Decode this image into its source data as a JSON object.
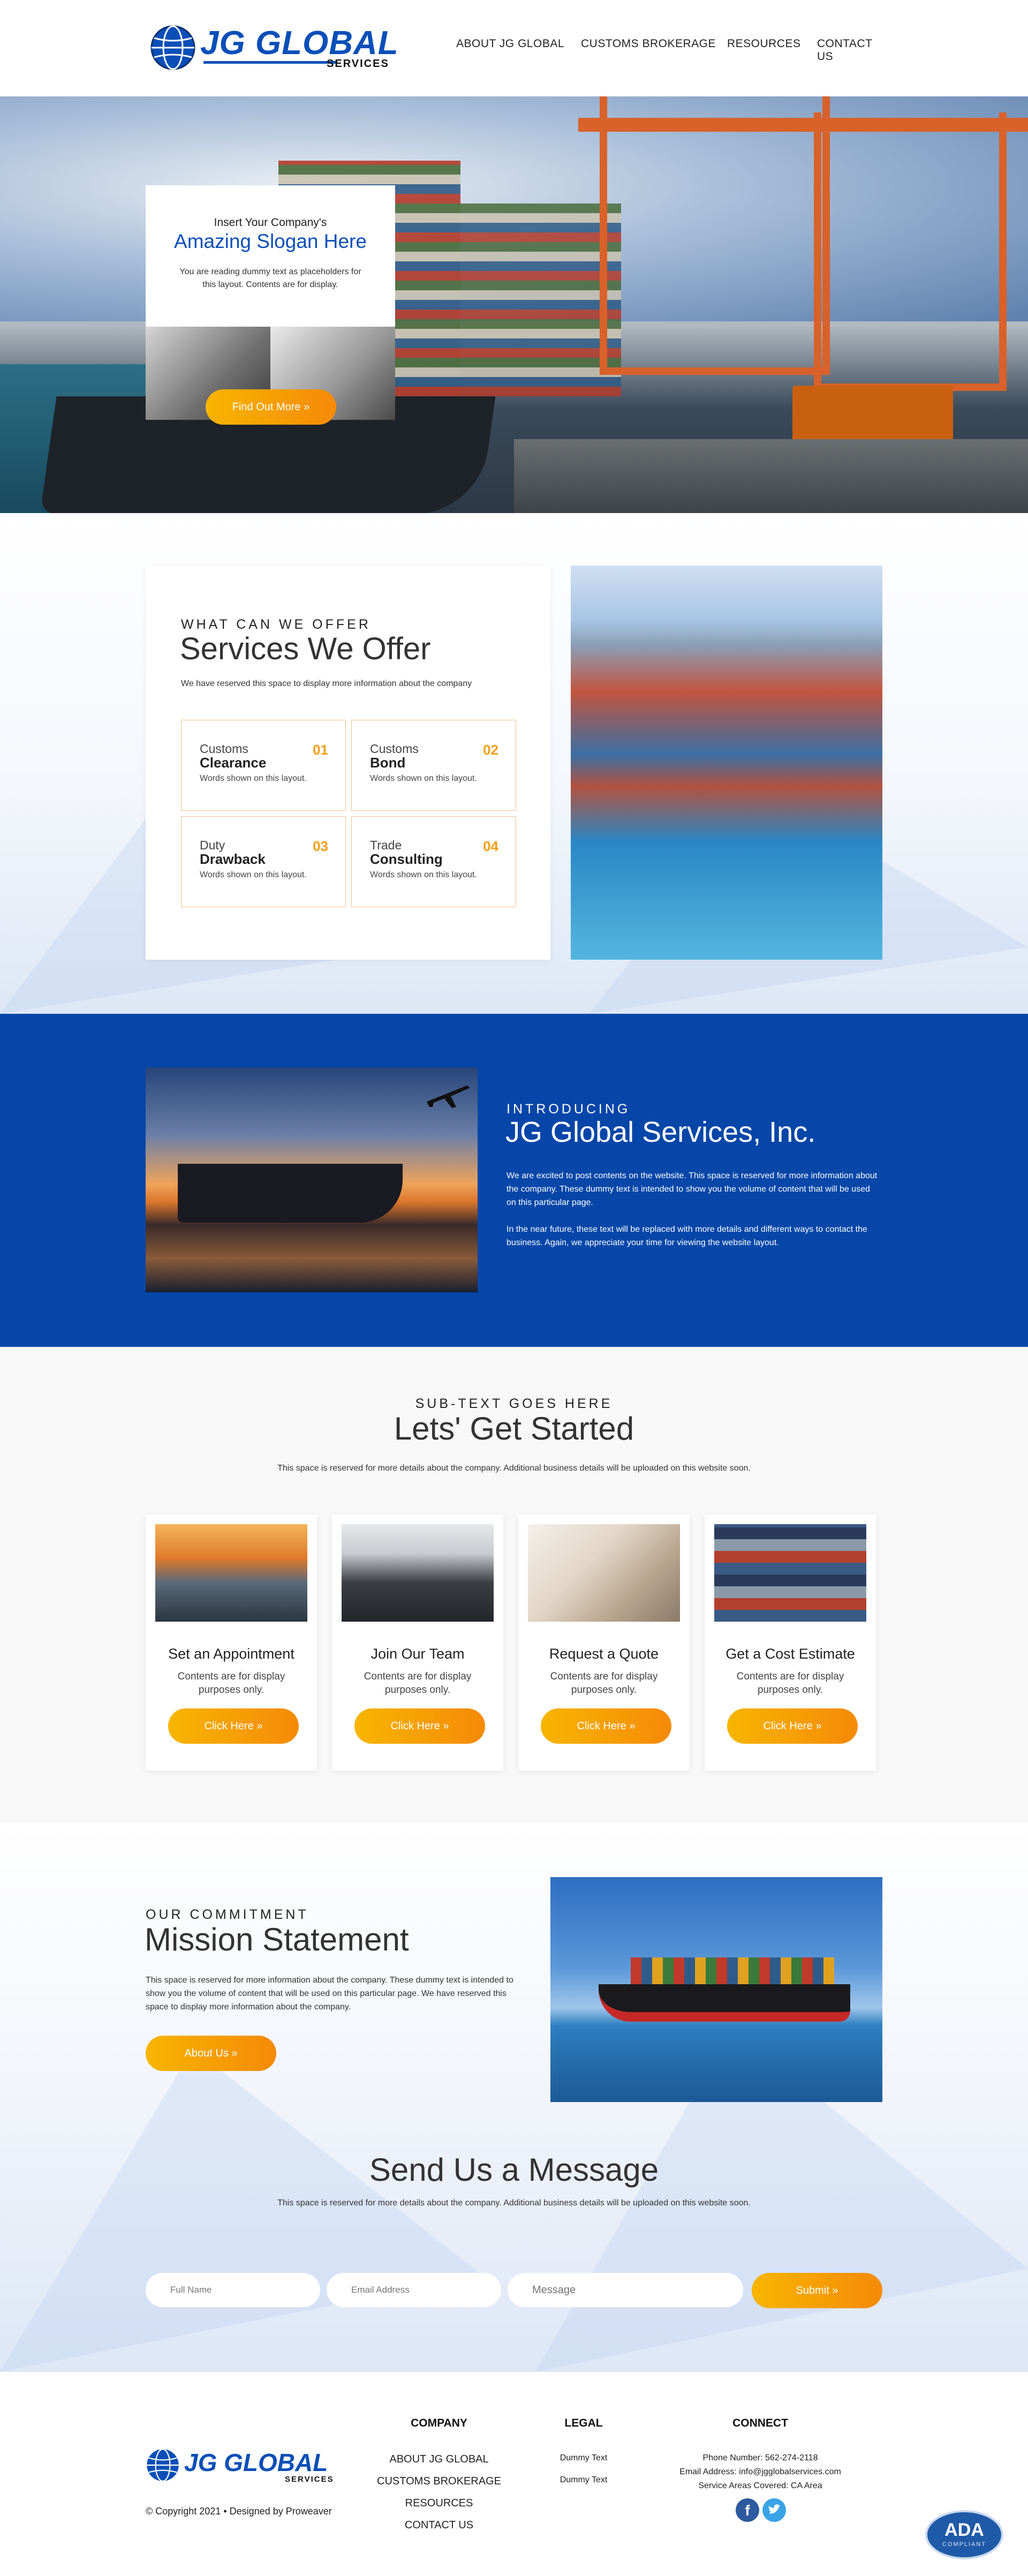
{
  "colors": {
    "brand_blue": "#0546a8",
    "accent_orange": "#f59f14",
    "dark_text": "#222222"
  },
  "header": {
    "logo": {
      "main": "JG GLOBAL",
      "sub": "SERVICES"
    },
    "nav": [
      "ABOUT JG GLOBAL",
      "CUSTOMS BROKERAGE",
      "RESOURCES",
      "CONTACT US"
    ]
  },
  "hero": {
    "pre": "Insert Your Company's",
    "slogan": "Amazing Slogan Here",
    "desc": "You are reading dummy text as placeholders for this layout. Contents are for display.",
    "button": "Find Out More »"
  },
  "services": {
    "eyebrow": "WHAT CAN WE OFFER",
    "title": "Services We Offer",
    "desc": "We have reserved this space to display more information about the company",
    "items": [
      {
        "line1": "Customs",
        "line2": "Clearance",
        "num": "01",
        "desc": "Words shown on this layout."
      },
      {
        "line1": "Customs",
        "line2": "Bond",
        "num": "02",
        "desc": "Words shown on this layout."
      },
      {
        "line1": "Duty",
        "line2": "Drawback",
        "num": "03",
        "desc": "Words shown on this layout."
      },
      {
        "line1": "Trade",
        "line2": "Consulting",
        "num": "04",
        "desc": "Words shown on this layout."
      }
    ]
  },
  "intro": {
    "eyebrow": "INTRODUCING",
    "title": "JG Global Services, Inc.",
    "p1": "We are excited to post contents on the website. This space is reserved for more information about the company. These dummy text is intended to show you the volume of content that will be used on this particular page.",
    "p2": "In the near future, these text will be replaced with more details and different ways to contact the business.  Again, we appreciate your time for viewing the website layout."
  },
  "started": {
    "eyebrow": "SUB-TEXT GOES HERE",
    "title": "Lets' Get Started",
    "desc": "This space is reserved for more details about the company. Additional business details will be uploaded on this website soon.",
    "cards": [
      {
        "title": "Set an Appointment",
        "text": "Contents are for display purposes only.",
        "button": "Click Here »"
      },
      {
        "title": "Join Our Team",
        "text": "Contents are for display purposes only.",
        "button": "Click Here »"
      },
      {
        "title": "Request a Quote",
        "text": "Contents are for display purposes only.",
        "button": "Click Here »"
      },
      {
        "title": "Get a Cost Estimate",
        "text": "Contents are for display purposes only.",
        "button": "Click Here »"
      }
    ]
  },
  "mission": {
    "eyebrow": "OUR COMMITMENT",
    "title": "Mission Statement",
    "text": "This space is reserved for more information about the company. These dummy text is intended to show you the volume of content that will be used on this particular page. We have reserved this space to display more information about the company.",
    "button": "About Us »"
  },
  "message": {
    "title": "Send Us a Message",
    "desc": "This space is reserved for more details about the company. Additional business details will be uploaded on this website soon.",
    "full_name_placeholder": "Full Name",
    "email_placeholder": "Email Address",
    "message_placeholder": "Message",
    "submit": "Submit »"
  },
  "footer": {
    "copyright": "© Copyright 2021 • Designed by Proweaver",
    "company_heading": "COMPANY",
    "company_links": [
      "ABOUT JG GLOBAL",
      "CUSTOMS BROKERAGE",
      "RESOURCES",
      "CONTACT US"
    ],
    "legal_heading": "LEGAL",
    "legal_links": [
      "Dummy Text",
      "Dummy Text"
    ],
    "connect_heading": "CONNECT",
    "phone": "Phone Number: 562-274-2118",
    "email": "Email Address: info@jgglobalservices.com",
    "areas": "Service Areas Covered: CA Area",
    "social": [
      "facebook-icon",
      "twitter-icon"
    ],
    "ada": {
      "main": "ADA",
      "sub": "COMPLIANT"
    }
  }
}
